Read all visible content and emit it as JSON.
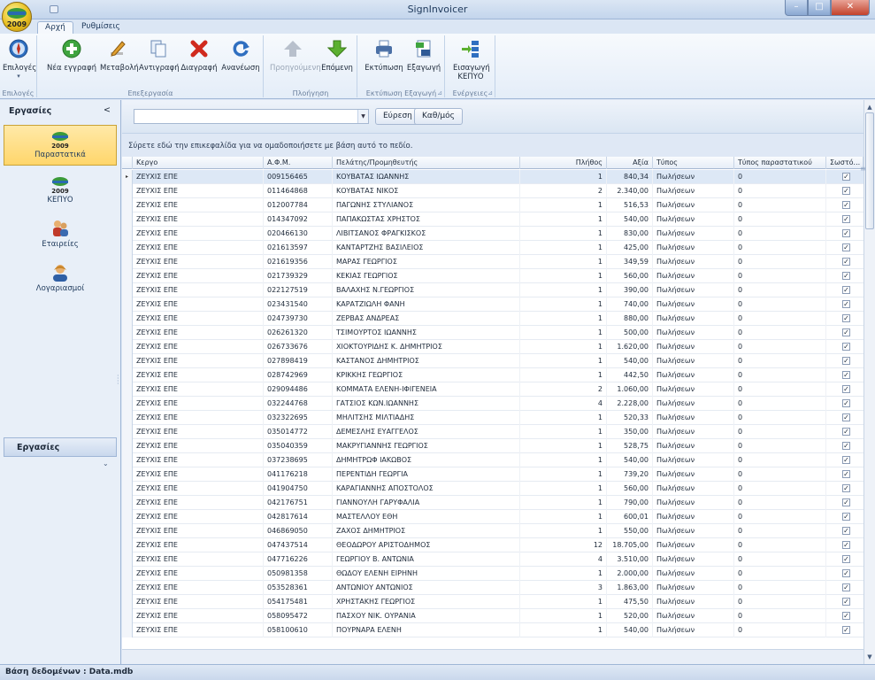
{
  "window": {
    "title": "SignInvoicer",
    "minimize": "–",
    "maximize": "□",
    "close": "✕"
  },
  "app_logo_text": "2009",
  "tabs": [
    "Αρχή",
    "Ρυθμίσεις"
  ],
  "ribbon": {
    "groups": [
      {
        "label": "Επιλογές",
        "buttons": [
          {
            "label": "Επιλογές",
            "icon": "compass-icon"
          }
        ]
      },
      {
        "label": "Επεξεργασία",
        "buttons": [
          {
            "label": "Νέα εγγραφή",
            "icon": "add-icon"
          },
          {
            "label": "Μεταβολή",
            "icon": "edit-icon"
          },
          {
            "label": "Αντιγραφή",
            "icon": "copy-icon"
          },
          {
            "label": "Διαγραφή",
            "icon": "delete-icon"
          },
          {
            "label": "Ανανέωση",
            "icon": "refresh-icon"
          }
        ]
      },
      {
        "label": "Πλοήγηση",
        "buttons": [
          {
            "label": "Προηγούμενη",
            "icon": "arrow-up-icon",
            "disabled": true
          },
          {
            "label": "Επόμενη",
            "icon": "arrow-down-icon"
          }
        ]
      },
      {
        "label": "Εκτύπωση Εξαγωγή",
        "buttons": [
          {
            "label": "Εκτύπωση",
            "icon": "printer-icon"
          },
          {
            "label": "Εξαγωγή",
            "icon": "export-icon"
          }
        ]
      },
      {
        "label": "Ενέργειες",
        "buttons": [
          {
            "label": "Εισαγωγή ΚΕΠΥΟ",
            "icon": "import-icon"
          }
        ]
      }
    ]
  },
  "sidebar": {
    "header": "Εργασίες",
    "collapse_glyph": "<",
    "items": [
      {
        "label": "Παραστατικά",
        "icon": "invoice-2009-icon",
        "active": true
      },
      {
        "label": "ΚΕΠΥΟ",
        "icon": "kepyo-2009-icon"
      },
      {
        "label": "Εταιρείες",
        "icon": "companies-icon"
      },
      {
        "label": "Λογαριασμοί",
        "icon": "user-account-icon"
      }
    ],
    "group_button": "Εργασίες",
    "more_glyph": "⌄"
  },
  "search": {
    "find_button": "Εύρεση",
    "clear_button": "Καθ/μός"
  },
  "groupby_hint": "Σύρετε εδώ την επικεφαλίδα για να ομαδοποιήσετε με βάση αυτό το πεδίο.",
  "grid": {
    "columns": [
      "Κεργο",
      "Α.Φ.Μ.",
      "Πελάτης/Προμηθευτής",
      "Πλήθος",
      "Αξία",
      "Τύπος",
      "Τύπος παραστατικού",
      "Σωστό..."
    ],
    "rows": [
      [
        "ΖΕΥΧΙΣ ΕΠΕ",
        "009156465",
        "ΚΟΥΒΑΤΑΣ ΙΩΑΝΝΗΣ",
        "1",
        "840,34",
        "Πωλήσεων",
        "0"
      ],
      [
        "ΖΕΥΧΙΣ ΕΠΕ",
        "011464868",
        "ΚΟΥΒΑΤΑΣ ΝΙΚΟΣ",
        "2",
        "2.340,00",
        "Πωλήσεων",
        "0"
      ],
      [
        "ΖΕΥΧΙΣ ΕΠΕ",
        "012007784",
        "ΠΑΓΩΝΗΣ ΣΤΥΛΙΑΝΟΣ",
        "1",
        "516,53",
        "Πωλήσεων",
        "0"
      ],
      [
        "ΖΕΥΧΙΣ ΕΠΕ",
        "014347092",
        "ΠΑΠΑΚΩΣΤΑΣ ΧΡΗΣΤΟΣ",
        "1",
        "540,00",
        "Πωλήσεων",
        "0"
      ],
      [
        "ΖΕΥΧΙΣ ΕΠΕ",
        "020466130",
        "ΛΙΒΙΤΣΑΝΟΣ ΦΡΑΓΚΙΣΚΟΣ",
        "1",
        "830,00",
        "Πωλήσεων",
        "0"
      ],
      [
        "ΖΕΥΧΙΣ ΕΠΕ",
        "021613597",
        "ΚΑΝΤΑΡΤΖΗΣ ΒΑΣΙΛΕΙΟΣ",
        "1",
        "425,00",
        "Πωλήσεων",
        "0"
      ],
      [
        "ΖΕΥΧΙΣ ΕΠΕ",
        "021619356",
        "ΜΑΡΑΣ ΓΕΩΡΓΙΟΣ",
        "1",
        "349,59",
        "Πωλήσεων",
        "0"
      ],
      [
        "ΖΕΥΧΙΣ ΕΠΕ",
        "021739329",
        "ΚΕΚΙΑΣ ΓΕΩΡΓΙΟΣ",
        "1",
        "560,00",
        "Πωλήσεων",
        "0"
      ],
      [
        "ΖΕΥΧΙΣ ΕΠΕ",
        "022127519",
        "ΒΑΛΑΧΗΣ Ν.ΓΕΩΡΓΙΟΣ",
        "1",
        "390,00",
        "Πωλήσεων",
        "0"
      ],
      [
        "ΖΕΥΧΙΣ ΕΠΕ",
        "023431540",
        "ΚΑΡΑΤΖΙΩΛΗ ΦΑΝΗ",
        "1",
        "740,00",
        "Πωλήσεων",
        "0"
      ],
      [
        "ΖΕΥΧΙΣ ΕΠΕ",
        "024739730",
        "ΖΕΡΒΑΣ ΑΝΔΡΕΑΣ",
        "1",
        "880,00",
        "Πωλήσεων",
        "0"
      ],
      [
        "ΖΕΥΧΙΣ ΕΠΕ",
        "026261320",
        "ΤΣΙΜΟΥΡΤΟΣ ΙΩΑΝΝΗΣ",
        "1",
        "500,00",
        "Πωλήσεων",
        "0"
      ],
      [
        "ΖΕΥΧΙΣ ΕΠΕ",
        "026733676",
        "ΧΙΟΚΤΟΥΡΙΔΗΣ Κ. ΔΗΜΗΤΡΙΟΣ",
        "1",
        "1.620,00",
        "Πωλήσεων",
        "0"
      ],
      [
        "ΖΕΥΧΙΣ ΕΠΕ",
        "027898419",
        "ΚΑΣΤΑΝΟΣ ΔΗΜΗΤΡΙΟΣ",
        "1",
        "540,00",
        "Πωλήσεων",
        "0"
      ],
      [
        "ΖΕΥΧΙΣ ΕΠΕ",
        "028742969",
        "ΚΡΙΚΚΗΣ ΓΕΩΡΓΙΟΣ",
        "1",
        "442,50",
        "Πωλήσεων",
        "0"
      ],
      [
        "ΖΕΥΧΙΣ ΕΠΕ",
        "029094486",
        "ΚΟΜΜΑΤΑ ΕΛΕΝΗ-ΙΦΙΓΕΝΕΙΑ",
        "2",
        "1.060,00",
        "Πωλήσεων",
        "0"
      ],
      [
        "ΖΕΥΧΙΣ ΕΠΕ",
        "032244768",
        "ΓΑΤΣΙΟΣ ΚΩΝ.ΙΩΑΝΝΗΣ",
        "4",
        "2.228,00",
        "Πωλήσεων",
        "0"
      ],
      [
        "ΖΕΥΧΙΣ ΕΠΕ",
        "032322695",
        "ΜΗΛΙΤΣΗΣ ΜΙΛΤΙΑΔΗΣ",
        "1",
        "520,33",
        "Πωλήσεων",
        "0"
      ],
      [
        "ΖΕΥΧΙΣ ΕΠΕ",
        "035014772",
        "ΔΕΜΕΣΛΗΣ ΕΥΑΓΓΕΛΟΣ",
        "1",
        "350,00",
        "Πωλήσεων",
        "0"
      ],
      [
        "ΖΕΥΧΙΣ ΕΠΕ",
        "035040359",
        "ΜΑΚΡΥΓΙΑΝΝΗΣ ΓΕΩΡΓΙΟΣ",
        "1",
        "528,75",
        "Πωλήσεων",
        "0"
      ],
      [
        "ΖΕΥΧΙΣ ΕΠΕ",
        "037238695",
        "ΔΗΜΗΤΡΩΦ ΙΑΚΩΒΟΣ",
        "1",
        "540,00",
        "Πωλήσεων",
        "0"
      ],
      [
        "ΖΕΥΧΙΣ ΕΠΕ",
        "041176218",
        "ΠΕΡΕΝΤΙΔΗ ΓΕΩΡΓΙΑ",
        "1",
        "739,20",
        "Πωλήσεων",
        "0"
      ],
      [
        "ΖΕΥΧΙΣ ΕΠΕ",
        "041904750",
        "ΚΑΡΑΓΙΑΝΝΗΣ ΑΠΟΣΤΟΛΟΣ",
        "1",
        "560,00",
        "Πωλήσεων",
        "0"
      ],
      [
        "ΖΕΥΧΙΣ ΕΠΕ",
        "042176751",
        "ΓΙΑΝΝΟΥΛΗ ΓΑΡΥΦΑΛΙΑ",
        "1",
        "790,00",
        "Πωλήσεων",
        "0"
      ],
      [
        "ΖΕΥΧΙΣ ΕΠΕ",
        "042817614",
        "ΜΑΣΤΕΛΛΟΥ ΕΘΗ",
        "1",
        "600,01",
        "Πωλήσεων",
        "0"
      ],
      [
        "ΖΕΥΧΙΣ ΕΠΕ",
        "046869050",
        "ΖΑΧΟΣ ΔΗΜΗΤΡΙΟΣ",
        "1",
        "550,00",
        "Πωλήσεων",
        "0"
      ],
      [
        "ΖΕΥΧΙΣ ΕΠΕ",
        "047437514",
        "ΘΕΟΔΩΡΟΥ ΑΡΙΣΤΟΔΗΜΟΣ",
        "12",
        "18.705,00",
        "Πωλήσεων",
        "0"
      ],
      [
        "ΖΕΥΧΙΣ ΕΠΕ",
        "047716226",
        "ΓΕΩΡΓΙΟΥ Β. ΑΝΤΩΝΙΑ",
        "4",
        "3.510,00",
        "Πωλήσεων",
        "0"
      ],
      [
        "ΖΕΥΧΙΣ ΕΠΕ",
        "050981358",
        "ΘΩΔΟΥ ΕΛΕΝΗ ΕΙΡΗΝΗ",
        "1",
        "2.000,00",
        "Πωλήσεων",
        "0"
      ],
      [
        "ΖΕΥΧΙΣ ΕΠΕ",
        "053528361",
        "ΑΝΤΩΝΙΟΥ ΑΝΤΩΝΙΟΣ",
        "3",
        "1.863,00",
        "Πωλήσεων",
        "0"
      ],
      [
        "ΖΕΥΧΙΣ ΕΠΕ",
        "054175481",
        "ΧΡΗΣΤΑΚΗΣ ΓΕΩΡΓΙΟΣ",
        "1",
        "475,50",
        "Πωλήσεων",
        "0"
      ],
      [
        "ΖΕΥΧΙΣ ΕΠΕ",
        "058095472",
        "ΠΑΣΧΟΥ ΝΙΚ. ΟΥΡΑΝΙΑ",
        "1",
        "520,00",
        "Πωλήσεων",
        "0"
      ],
      [
        "ΖΕΥΧΙΣ ΕΠΕ",
        "058100610",
        "ΠΟΥΡΝΑΡΑ ΕΛΕΝΗ",
        "1",
        "540,00",
        "Πωλήσεων",
        "0"
      ]
    ],
    "checked_glyph": "✓",
    "row_indicator": "▸"
  },
  "status": {
    "database_label": "Βάση δεδομένων : Data.mdb"
  },
  "colors": {
    "accent": "#ffd66b",
    "ribbon_border": "#9fb6d6",
    "close_red": "#c2422b"
  }
}
